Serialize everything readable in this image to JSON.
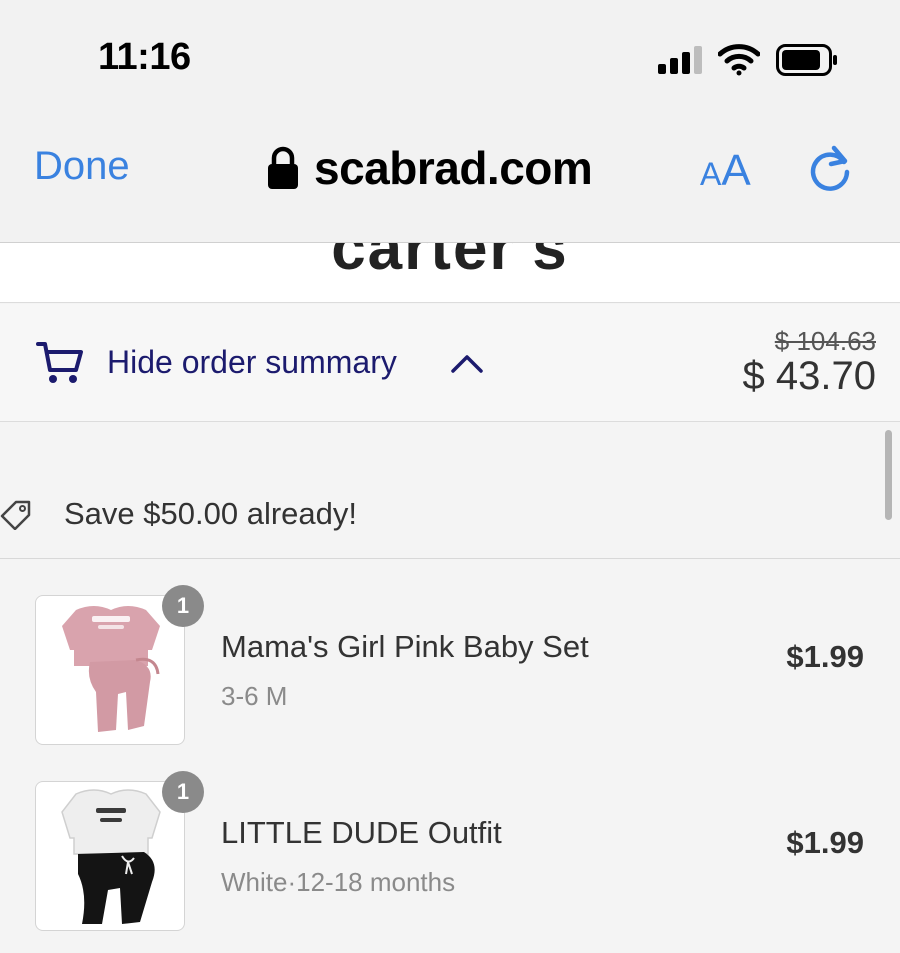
{
  "status_bar": {
    "time": "11:16"
  },
  "browser": {
    "done_label": "Done",
    "url": "scabrad.com",
    "text_size_small": "A",
    "text_size_large": "A"
  },
  "store": {
    "logo_text": "carter's"
  },
  "summary": {
    "toggle_label": "Hide order summary",
    "compare_price": "$ 104.63",
    "total_price": "$ 43.70"
  },
  "discount": {
    "save_text": "Save $50.00 already!"
  },
  "items": [
    {
      "quantity": "1",
      "name": "Mama's Girl Pink Baby Set",
      "variant": "3-6 M",
      "price": "$1.99"
    },
    {
      "quantity": "1",
      "name": "LITTLE DUDE Outfit",
      "variant": "White·12-18 months",
      "price": "$1.99"
    }
  ],
  "colors": {
    "ios_blue": "#3a82e0",
    "summary_navy": "#1c1b6e",
    "badge_gray": "#8a8a8a"
  }
}
